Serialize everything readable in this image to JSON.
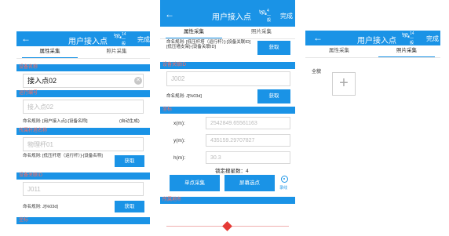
{
  "common": {
    "back": "←",
    "title": "用户接入点",
    "tab_attr": "属性采集",
    "tab_photo": "照片采集",
    "sat_count": "14",
    "fix": "一般",
    "done": "完成",
    "obtain": "获取"
  },
  "s1": {
    "sections": [
      "设备名称",
      "运行编号",
      "所属杆塔名称",
      "设备关联ID",
      "坐标"
    ],
    "name_value": "接入点02",
    "run_placeholder": "接入点02",
    "run_rule": "命名规则: [用户接入点]-[设备名称]",
    "run_auto": "(自动生成)",
    "pole_placeholder": "物理杆01",
    "pole_rule": "命名规则: [低压杆塔（运行杆）]-[设备名称]",
    "id_placeholder": "J011",
    "id_rule": "命名规则: J[%03d]"
  },
  "s2": {
    "sat_count": "4",
    "rule1": "命名规则: [低压杆塔（运行杆）]-[设备关联ID][低压墙支架]-[设备关联ID]",
    "id_section": "设备关联ID",
    "id_placeholder": "J002",
    "id_rule": "命名规则: J[%03d]",
    "coord_section": "坐标",
    "x_label": "x(m):",
    "x_value": "2542849.65561163",
    "y_label": "y(m):",
    "y_value": "435159.29707827",
    "h_label": "h(m):",
    "h_value": "30.3",
    "sats_locked": "锁定搜星数：4",
    "btn_single": "单点采集",
    "btn_screen": "屏幕选点",
    "record_label": "录线",
    "area_section": "所属地市"
  },
  "s3": {
    "photo_label": "全貌",
    "add_symbol": "+"
  }
}
